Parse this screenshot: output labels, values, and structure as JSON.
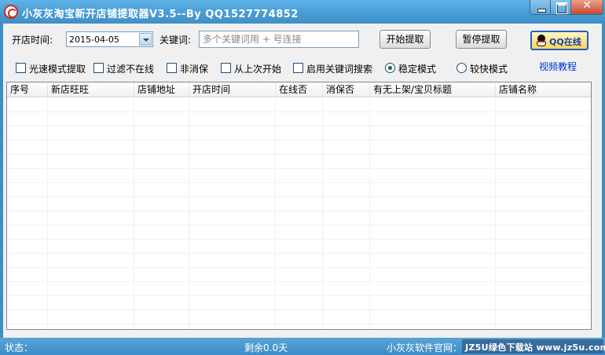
{
  "window": {
    "title": "小灰灰淘宝新开店铺提取器V3.5--By QQ1527774852",
    "close_glyph": "✕"
  },
  "toolbar": {
    "open_time_label": "开店时间:",
    "open_time_value": "2015-04-05",
    "keyword_label": "关键词:",
    "keyword_value": "",
    "keyword_placeholder": "多个关键词用 + 号连接",
    "start_label": "开始提取",
    "pause_label": "暂停提取",
    "qq_label": "QQ在线"
  },
  "options": {
    "checkboxes": [
      {
        "label": "光速模式提取",
        "checked": false
      },
      {
        "label": "过滤不在线",
        "checked": false
      },
      {
        "label": "非消保",
        "checked": false
      },
      {
        "label": "从上次开始",
        "checked": false
      },
      {
        "label": "启用关键词搜索",
        "checked": false
      }
    ],
    "radios": [
      {
        "label": "稳定模式",
        "selected": true
      },
      {
        "label": "较快模式",
        "selected": false
      }
    ],
    "video_link": "视频教程"
  },
  "table": {
    "columns": [
      "序号",
      "新店旺旺",
      "店铺地址",
      "开店时间",
      "在线否",
      "消保否",
      "有无上架/宝贝标题",
      "店铺名称"
    ],
    "rows": []
  },
  "status": {
    "state_label": "状态：",
    "remaining": "剩余0.0天",
    "site_label": "小灰灰软件官网：",
    "watermark": "JZ5U绿色下载站 www.jz5u.com"
  },
  "colors": {
    "titlebar": "#4a9fd8",
    "statusbar": "#3d8cc6",
    "qq_border": "#2a5cc0",
    "link": "#0033cc"
  }
}
